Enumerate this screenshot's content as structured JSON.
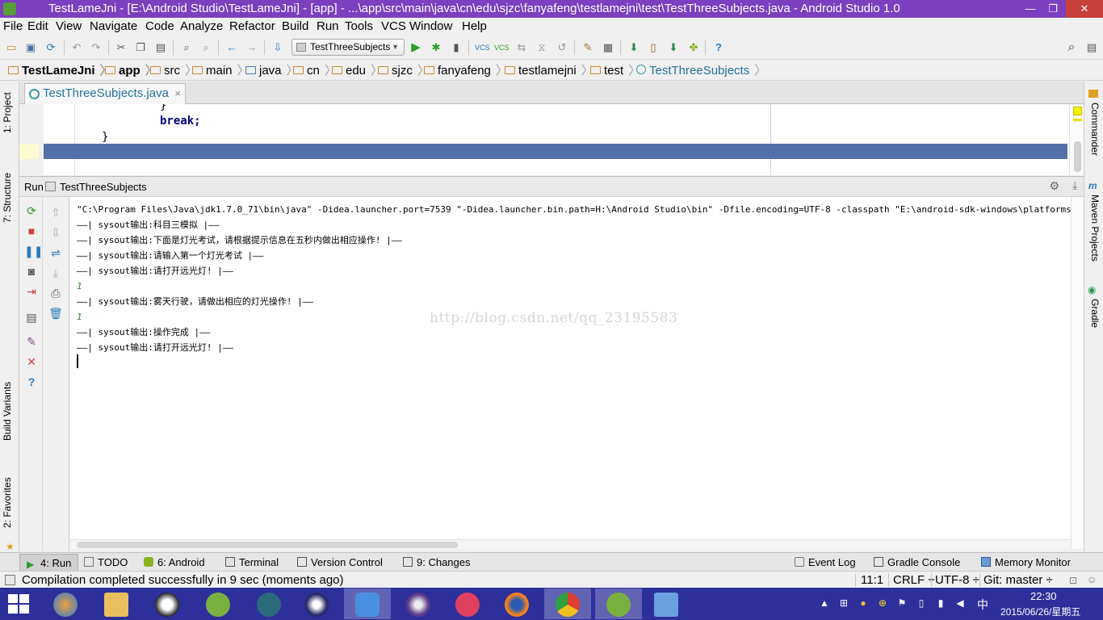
{
  "window": {
    "title": "TestLameJni - [E:\\Android Studio\\TestLameJni] - [app] - ...\\app\\src\\main\\java\\cn\\edu\\sjzc\\fanyafeng\\testlamejni\\test\\TestThreeSubjects.java - Android Studio 1.0",
    "minimize": "—",
    "restore": "❐",
    "close": "✕"
  },
  "menu": [
    "File",
    "Edit",
    "View",
    "Navigate",
    "Code",
    "Analyze",
    "Refactor",
    "Build",
    "Run",
    "Tools",
    "VCS",
    "Window",
    "Help"
  ],
  "toolbar": {
    "run_config": "TestThreeSubjects",
    "help": "?"
  },
  "breadcrumb": [
    "TestLameJni",
    "app",
    "src",
    "main",
    "java",
    "cn",
    "edu",
    "sjzc",
    "fanyafeng",
    "testlamejni",
    "test",
    "TestThreeSubjects"
  ],
  "left_strip": [
    "1: Project",
    "7: Structure",
    "Build Variants",
    "2: Favorites"
  ],
  "right_strip": [
    "Commander",
    "Maven Projects",
    "Gradle"
  ],
  "editor": {
    "tab_label": "TestThreeSubjects.java",
    "lines": [
      "}",
      "break;",
      "}"
    ]
  },
  "run_panel": {
    "label": "Run",
    "tab": "TestThreeSubjects",
    "console": [
      "\"C:\\Program Files\\Java\\jdk1.7.0_71\\bin\\java\" -Didea.launcher.port=7539 \"-Didea.launcher.bin.path=H:\\Android Studio\\bin\" -Dfile.encoding=UTF-8 -classpath \"E:\\android-sdk-windows\\platforms\\android-21\\android",
      "——| sysout输出:科目三模拟 |——",
      "——| sysout输出:下面是灯光考试，请根据提示信息在五秒内做出相应操作! |——",
      "——| sysout输出:请输入第一个灯光考试 |——",
      "——| sysout输出:请打开远光灯! |——",
      "1",
      "——| sysout输出:雾天行驶，请做出相应的灯光操作! |——",
      "1",
      "——| sysout输出:操作完成 |——",
      "——| sysout输出:请打开远光灯! |——"
    ],
    "watermark": "http://blog.csdn.net/qq_23195583"
  },
  "bottom_tabs": {
    "run": "4: Run",
    "todo": "TODO",
    "android": "6: Android",
    "terminal": "Terminal",
    "vcs": "Version Control",
    "changes": "9: Changes",
    "event_log": "Event Log",
    "gradle_console": "Gradle Console",
    "memory_monitor": "Memory Monitor"
  },
  "status": {
    "message": "Compilation completed successfully in 9 sec (moments ago)",
    "position": "11:1",
    "line_sep": "CRLF ÷",
    "encoding": "UTF-8 ÷",
    "git": "Git: master ÷"
  },
  "taskbar": {
    "time": "22:30",
    "date": "2015/06/26/星期五",
    "ime": "中"
  },
  "colors": {
    "titlebar": "#7b3fbf",
    "taskbar": "#2d2f9a",
    "selection": "#5470a9",
    "keyword": "#000080"
  }
}
